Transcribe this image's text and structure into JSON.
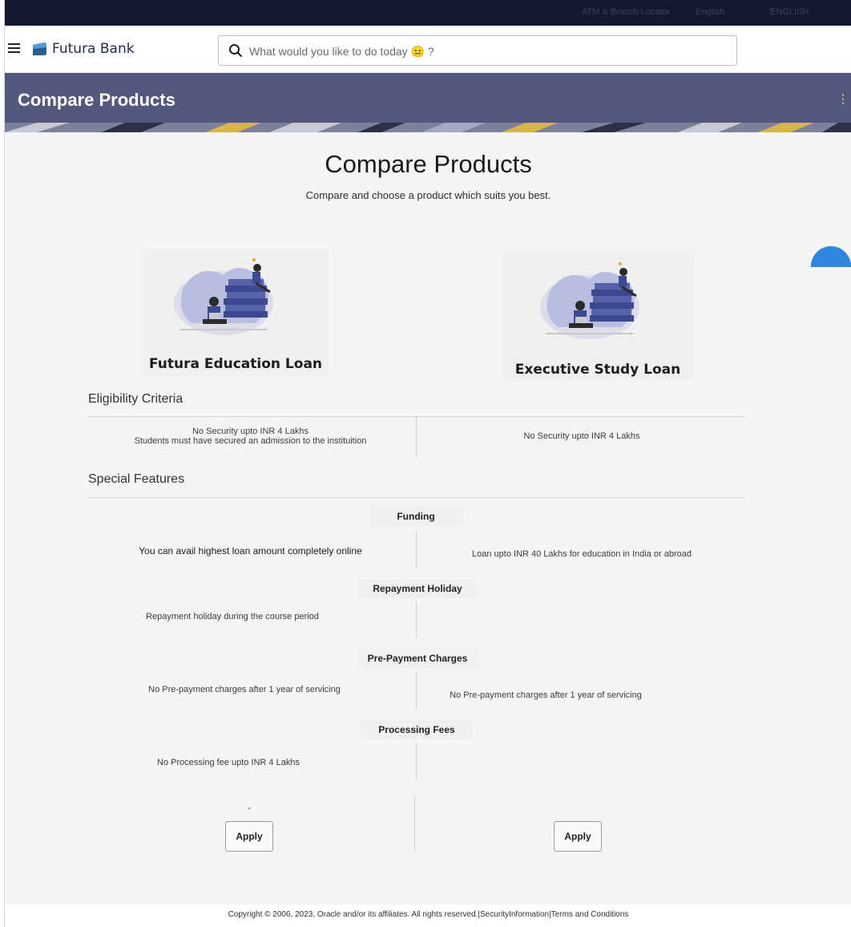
{
  "topbar": {
    "items": [
      "ATM & Branch Locator",
      "English",
      "ENGLISH"
    ]
  },
  "header": {
    "brand": "Futura Bank",
    "search_placeholder": "What would you like to do today 😐 ?"
  },
  "banner": {
    "title": "Compare Products"
  },
  "page": {
    "title": "Compare Products",
    "subtitle": "Compare and choose a product which suits you best."
  },
  "products": [
    {
      "name": "Futura Education Loan"
    },
    {
      "name": "Executive Study Loan"
    }
  ],
  "eligibility": {
    "title": "Eligibility Criteria",
    "left_line1": "No Security upto INR 4 Lakhs",
    "left_line2": "Students must have secured an admission to the instituition",
    "right": "No Security upto INR 4 Lakhs"
  },
  "features": {
    "title": "Special Features",
    "funding": {
      "label": "Funding",
      "left": "You can avail highest loan amount completely online",
      "right": "Loan upto INR 40 Lakhs for education in India or abroad"
    },
    "repayment": {
      "label": "Repayment Holiday",
      "left": "Repayment holiday during the course period",
      "right": ""
    },
    "prepayment": {
      "label": "Pre-Payment Charges",
      "left": "No Pre-payment charges after 1 year of servicing",
      "right": "No Pre-payment charges after 1 year of servicing"
    },
    "processing": {
      "label": "Processing Fees",
      "left": "No Processing fee upto INR 4 Lakhs",
      "right": ""
    }
  },
  "actions": {
    "dash": "-",
    "apply_left": "Apply",
    "apply_right": "Apply"
  },
  "footer": {
    "text": "Copyright © 2006, 2023, Oracle and/or its affiliates. All rights reserved.|SecurityInformation|Terms and Conditions"
  },
  "colors": {
    "topbar": "#14192f",
    "banner": "#53597d",
    "accent": "#2e86de",
    "illustration_primary": "#3b4a8f",
    "illustration_secondary": "#b9bde0"
  }
}
